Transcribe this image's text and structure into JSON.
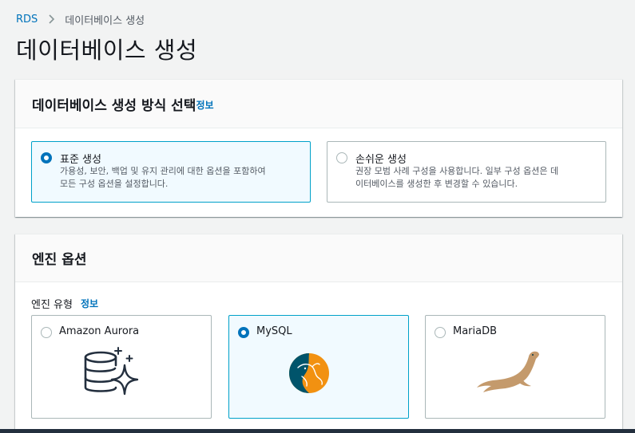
{
  "breadcrumb": {
    "root": "RDS",
    "current": "데이터베이스 생성"
  },
  "page_title": "데이터베이스 생성",
  "method_section": {
    "title": "데이터베이스 생성 방식 선택",
    "info": "정보",
    "options": [
      {
        "title": "표준 생성",
        "desc_line1": "가용성, 보안, 백업 및 유지 관리에 대한 옵션을 포함하여",
        "desc_line2": "모든 구성 옵션을 설정합니다.",
        "selected": true
      },
      {
        "title": "손쉬운 생성",
        "desc_line1": "권장 모범 사례 구성을 사용합니다. 일부 구성 옵션은 데",
        "desc_line2": "이터베이스를 생성한 후 변경할 수 있습니다.",
        "selected": false
      }
    ]
  },
  "engine_section": {
    "title": "엔진 옵션",
    "type_label": "엔진 유형",
    "info": "정보",
    "engines": [
      {
        "name": "Amazon Aurora",
        "icon": "aurora-database-icon",
        "selected": false
      },
      {
        "name": "MySQL",
        "icon": "mysql-dolphin-icon",
        "selected": true
      },
      {
        "name": "MariaDB",
        "icon": "mariadb-sealion-icon",
        "selected": false
      }
    ]
  },
  "colors": {
    "link": "#0073bb",
    "selected_border": "#00a1c9",
    "selected_bg": "#f1faff",
    "mysql_blue": "#00546b",
    "mysql_orange": "#f29111",
    "mariadb_brown": "#c49a6c",
    "aurora_dark": "#232f3e"
  }
}
